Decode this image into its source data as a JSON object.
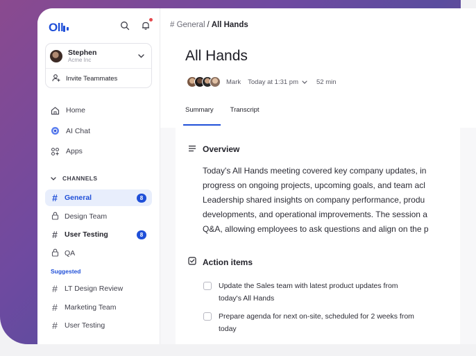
{
  "brand": {
    "logo_text": "Oll"
  },
  "account": {
    "name": "Stephen",
    "org": "Acme Inc",
    "invite_label": "Invite Teammates"
  },
  "nav": [
    {
      "label": "Home",
      "icon": "home-icon"
    },
    {
      "label": "AI Chat",
      "icon": "ai-chat-icon"
    },
    {
      "label": "Apps",
      "icon": "apps-icon"
    }
  ],
  "channels": {
    "header": "CHANNELS",
    "items": [
      {
        "label": "General",
        "icon": "hash",
        "badge": "8",
        "active": true
      },
      {
        "label": "Design Team",
        "icon": "lock"
      },
      {
        "label": "User Testing",
        "icon": "hash",
        "badge": "8",
        "bold": true
      },
      {
        "label": "QA",
        "icon": "lock"
      }
    ]
  },
  "suggested": {
    "header": "Suggested",
    "items": [
      {
        "label": "LT Design Review"
      },
      {
        "label": "Marketing Team"
      },
      {
        "label": "User Testing"
      }
    ]
  },
  "breadcrumb": {
    "channel": "# General",
    "separator": "/",
    "current": "All Hands"
  },
  "meeting": {
    "title": "All Hands",
    "host": "Mark",
    "when": "Today at 1:31 pm",
    "duration": "52 min"
  },
  "tabs": {
    "summary": "Summary",
    "transcript": "Transcript"
  },
  "overview": {
    "heading": "Overview",
    "lines": [
      "Today's All Hands meeting covered key company updates, in",
      "progress on ongoing projects, upcoming goals, and team acl",
      "Leadership shared insights on company performance, produ",
      "developments, and operational improvements. The session a",
      "Q&A, allowing employees to ask questions and align on the p"
    ]
  },
  "action_items": {
    "heading": "Action items",
    "items": [
      {
        "line1": "Update the Sales team with latest product updates from",
        "line2": "today's All Hands"
      },
      {
        "line1": "Prepare agenda for next on-site, scheduled for 2 weeks from",
        "line2": "today"
      }
    ]
  },
  "colors": {
    "accent": "#1f4fd8",
    "badge_bg": "#1f4fd8",
    "active_bg": "#e8eefc",
    "notification_dot": "#e5484d"
  }
}
